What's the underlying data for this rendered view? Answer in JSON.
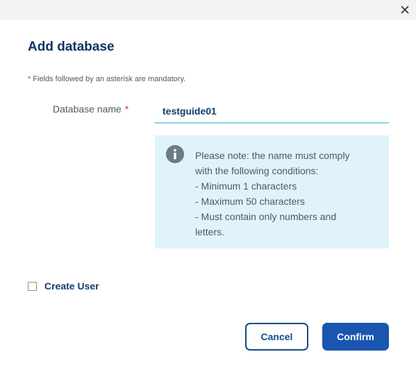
{
  "dialog": {
    "title": "Add database",
    "close_icon": "close-icon"
  },
  "form": {
    "mandatory_star": "*",
    "mandatory_note": "Fields followed by an asterisk are mandatory.",
    "database_name": {
      "label": "Database name",
      "required_star": "*",
      "value": "testguide01"
    },
    "note": {
      "icon": "info-icon",
      "lines": [
        "Please note: the name must comply",
        "with the following conditions:",
        "- Minimum 1 characters",
        "- Maximum 50 characters",
        "- Must contain only numbers and",
        "letters."
      ]
    },
    "create_user": {
      "label": "Create User",
      "checked": false
    }
  },
  "actions": {
    "cancel_label": "Cancel",
    "confirm_label": "Confirm"
  },
  "colors": {
    "title": "#0f3366",
    "note_background": "#e0f3fb",
    "input_underline": "#84d3e6",
    "required_star": "#d93025",
    "cancel_border": "#114b8b",
    "confirm_background": "#1a55b0"
  }
}
